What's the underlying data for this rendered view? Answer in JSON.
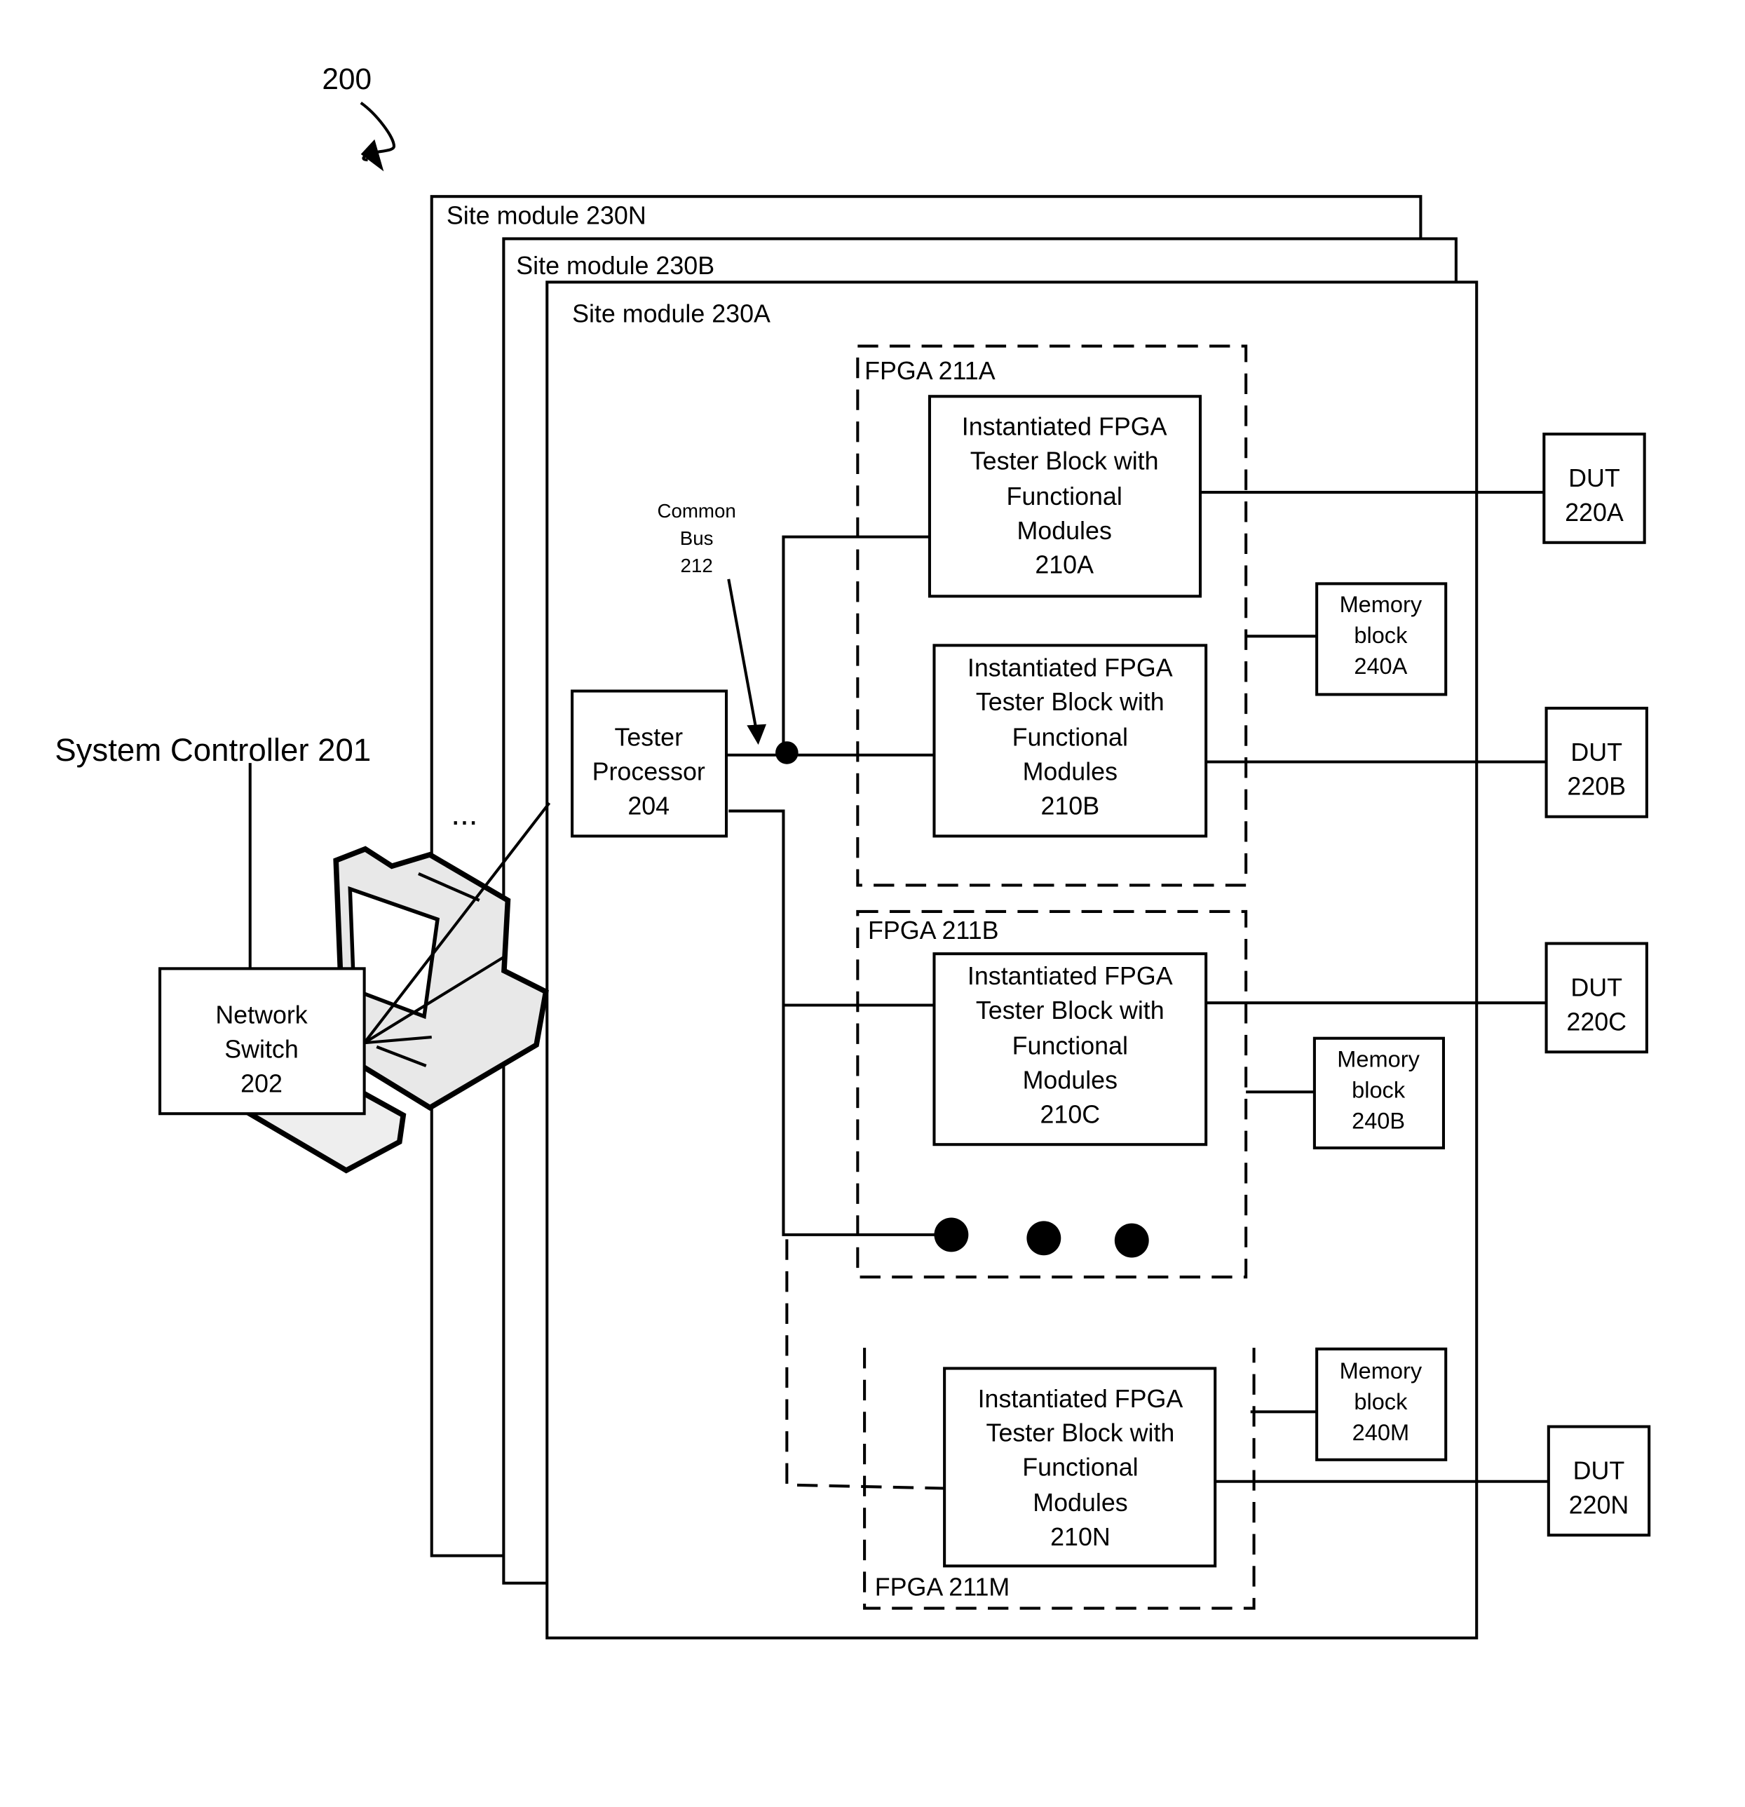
{
  "figure": {
    "reference": "200",
    "system_controller": "System Controller 201",
    "network_switch": [
      "Network",
      "Switch",
      "202"
    ],
    "ellipsis": "...",
    "site_modules": [
      "Site module 230N",
      "Site module 230B",
      "Site module 230A"
    ],
    "tester_processor": [
      "Tester",
      "Processor",
      "204"
    ],
    "common_bus": [
      "Common",
      "Bus",
      "212"
    ],
    "fpgas": [
      "FPGA 211A",
      "FPGA 211B",
      "FPGA 211M"
    ],
    "tester_blocks": [
      [
        "Instantiated FPGA",
        "Tester Block with",
        "Functional",
        "Modules",
        "210A"
      ],
      [
        "Instantiated FPGA",
        "Tester Block with",
        "Functional",
        "Modules",
        "210B"
      ],
      [
        "Instantiated FPGA",
        "Tester Block with",
        "Functional",
        "Modules",
        "210C"
      ],
      [
        "Instantiated FPGA",
        "Tester Block with",
        "Functional",
        "Modules",
        "210N"
      ]
    ],
    "memory_blocks": [
      [
        "Memory",
        "block",
        "240A"
      ],
      [
        "Memory",
        "block",
        "240B"
      ],
      [
        "Memory",
        "block",
        "240M"
      ]
    ],
    "duts": [
      [
        "DUT",
        "220A"
      ],
      [
        "DUT",
        "220B"
      ],
      [
        "DUT",
        "220C"
      ],
      [
        "DUT",
        "220N"
      ]
    ]
  }
}
